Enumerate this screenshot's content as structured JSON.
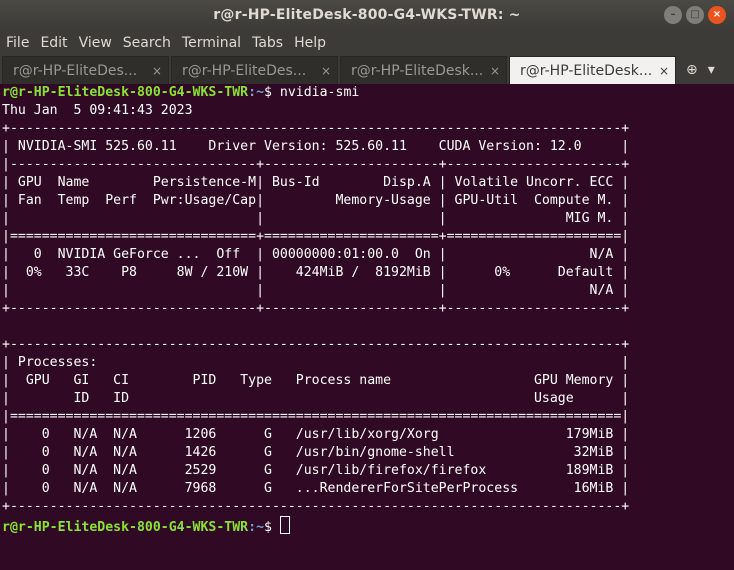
{
  "window": {
    "title": "r@r-HP-EliteDesk-800-G4-WKS-TWR: ~"
  },
  "window_controls": {
    "minimize": "–",
    "maximize": "□",
    "close": "×"
  },
  "menubar": {
    "items": [
      "File",
      "Edit",
      "View",
      "Search",
      "Terminal",
      "Tabs",
      "Help"
    ]
  },
  "tabs": [
    {
      "label": "r@r-HP-EliteDes...",
      "close": "×"
    },
    {
      "label": "r@r-HP-EliteDes...",
      "close": "×"
    },
    {
      "label": "r@r-HP-EliteDesk...",
      "close": "×"
    },
    {
      "label": "r@r-HP-EliteDesk...",
      "close": "×",
      "active": true
    }
  ],
  "tab_tools": {
    "new_tab": "⊕",
    "menu": "▾"
  },
  "terminal": {
    "prompt_user": "r@r-HP-EliteDesk-800-G4-WKS-TWR",
    "prompt_path": ":~",
    "prompt_symbol": "$ ",
    "command": "nvidia-smi",
    "lines": [
      "Thu Jan  5 09:41:43 2023",
      "+-----------------------------------------------------------------------------+",
      "| NVIDIA-SMI 525.60.11    Driver Version: 525.60.11    CUDA Version: 12.0     |",
      "|-------------------------------+----------------------+----------------------+",
      "| GPU  Name        Persistence-M| Bus-Id        Disp.A | Volatile Uncorr. ECC |",
      "| Fan  Temp  Perf  Pwr:Usage/Cap|         Memory-Usage | GPU-Util  Compute M. |",
      "|                               |                      |               MIG M. |",
      "|===============================+======================+======================|",
      "|   0  NVIDIA GeForce ...  Off  | 00000000:01:00.0  On |                  N/A |",
      "|  0%   33C    P8     8W / 210W |    424MiB /  8192MiB |      0%      Default |",
      "|                               |                      |                  N/A |",
      "+-------------------------------+----------------------+----------------------+",
      "",
      "+-----------------------------------------------------------------------------+",
      "| Processes:                                                                  |",
      "|  GPU   GI   CI        PID   Type   Process name                  GPU Memory |",
      "|        ID   ID                                                   Usage      |",
      "|=============================================================================|",
      "|    0   N/A  N/A      1206      G   /usr/lib/xorg/Xorg                179MiB |",
      "|    0   N/A  N/A      1426      G   /usr/bin/gnome-shell               32MiB |",
      "|    0   N/A  N/A      2529      G   /usr/lib/firefox/firefox          189MiB |",
      "|    0   N/A  N/A      7968      G   ...RendererForSitePerProcess       16MiB |",
      "+-----------------------------------------------------------------------------+"
    ]
  },
  "colors": {
    "terminal_bg": "#300a24",
    "prompt_user": "#8ae234",
    "prompt_path": "#729fcf",
    "close_button": "#e95420"
  }
}
